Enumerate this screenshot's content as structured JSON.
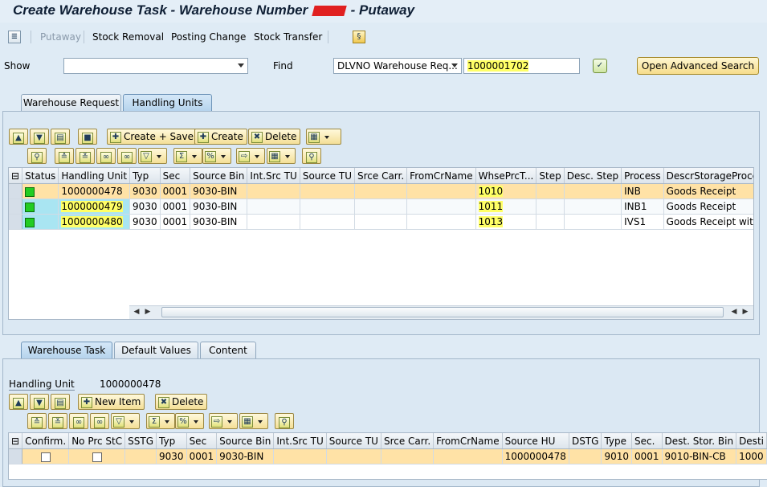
{
  "title": {
    "prefix": "Create Warehouse Task - Warehouse Number",
    "suffix": "- Putaway"
  },
  "toolbar": {
    "items": [
      "Putaway",
      "Stock Removal",
      "Posting Change",
      "Stock Transfer"
    ]
  },
  "search": {
    "show_label": "Show",
    "show_value": "",
    "find_label": "Find",
    "find_type": "DLVNO Warehouse Req...",
    "find_value": "1000001702",
    "advanced_button": "Open Advanced Search"
  },
  "upper": {
    "tabs": [
      "Warehouse Request",
      "Handling Units"
    ],
    "active_tab": "Handling Units",
    "buttons": {
      "create_save": "Create + Save",
      "create": "Create",
      "delete": "Delete"
    },
    "columns": [
      "Status",
      "Handling Unit",
      "Typ",
      "Sec",
      "Source Bin",
      "Int.Src TU",
      "Source TU",
      "Srce Carr.",
      "FromCrName",
      "WhsePrcT...",
      "Step",
      "Desc. Step",
      "Process",
      "DescrStorageProcess"
    ],
    "rows": [
      {
        "hu": "1000000478",
        "typ": "9030",
        "sec": "0001",
        "bin": "9030-BIN",
        "whse": "1010",
        "process": "INB",
        "descr": "Goods Receipt"
      },
      {
        "hu": "1000000479",
        "typ": "9030",
        "sec": "0001",
        "bin": "9030-BIN",
        "whse": "1011",
        "process": "INB1",
        "descr": "Goods Receipt"
      },
      {
        "hu": "1000000480",
        "typ": "9030",
        "sec": "0001",
        "bin": "9030-BIN",
        "whse": "1013",
        "process": "IVS1",
        "descr": "Goods Receipt with VAS"
      }
    ]
  },
  "lower": {
    "tabs": [
      "Warehouse Task",
      "Default Values",
      "Content"
    ],
    "active_tab": "Warehouse Task",
    "hu_label": "Handling Unit",
    "hu_value": "1000000478",
    "buttons": {
      "new_item": "New Item",
      "delete": "Delete"
    },
    "columns": [
      "Confirm.",
      "No Prc StC",
      "SSTG",
      "Typ",
      "Sec",
      "Source Bin",
      "Int.Src TU",
      "Source TU",
      "Srce Carr.",
      "FromCrName",
      "Source HU",
      "DSTG",
      "Type",
      "Sec.",
      "Dest. Stor. Bin",
      "Desti"
    ],
    "row": {
      "typ": "9030",
      "sec": "0001",
      "bin": "9030-BIN",
      "source_hu": "1000000478",
      "type": "9010",
      "sec2": "0001",
      "dest_bin": "9010-BIN-CB",
      "desti": "1000"
    }
  },
  "colors": {
    "selected_row": "#ffe2a6",
    "highlight": "#ffff66",
    "status_green": "#22cc22",
    "hu_cell": "#a9e5f2"
  }
}
